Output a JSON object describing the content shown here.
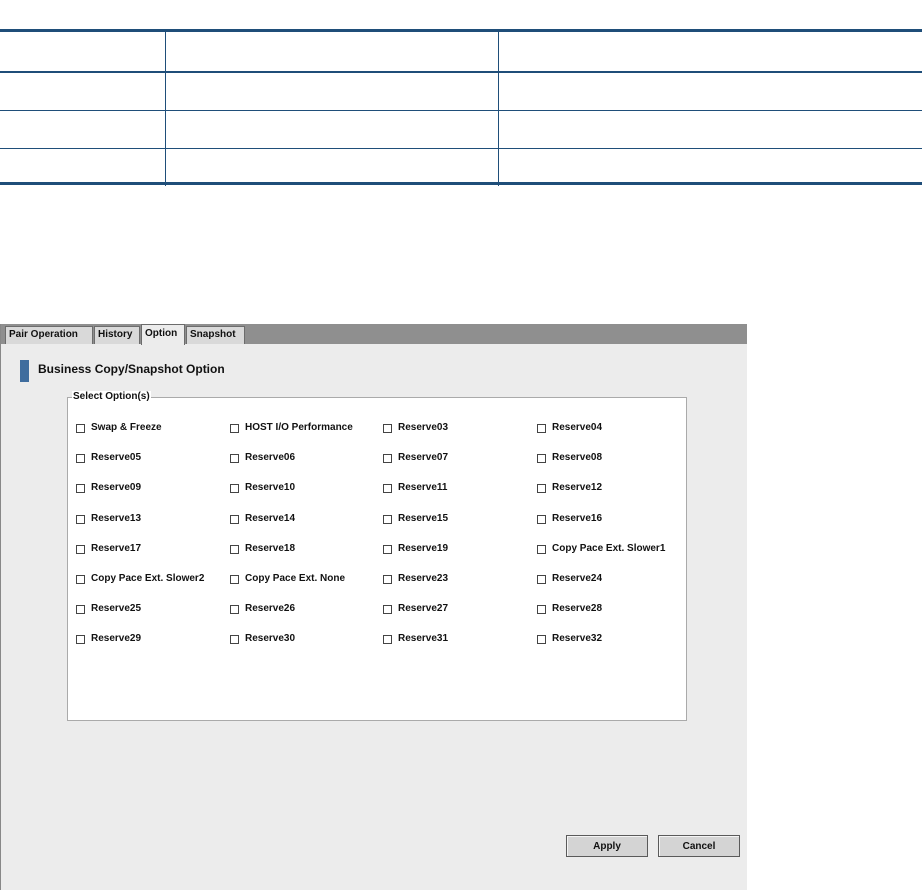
{
  "tabs": [
    {
      "label": "Pair Operation"
    },
    {
      "label": "History"
    },
    {
      "label": "Option",
      "active": true
    },
    {
      "label": "Snapshot"
    }
  ],
  "section": {
    "title": "Business Copy/Snapshot Option"
  },
  "group": {
    "legend": "Select Option(s)",
    "options": [
      "Swap & Freeze",
      "HOST I/O Performance",
      "Reserve03",
      "Reserve04",
      "Reserve05",
      "Reserve06",
      "Reserve07",
      "Reserve08",
      "Reserve09",
      "Reserve10",
      "Reserve11",
      "Reserve12",
      "Reserve13",
      "Reserve14",
      "Reserve15",
      "Reserve16",
      "Reserve17",
      "Reserve18",
      "Reserve19",
      "Copy Pace Ext. Slower1",
      "Copy Pace Ext. Slower2",
      "Copy Pace Ext. None",
      "Reserve23",
      "Reserve24",
      "Reserve25",
      "Reserve26",
      "Reserve27",
      "Reserve28",
      "Reserve29",
      "Reserve30",
      "Reserve31",
      "Reserve32"
    ]
  },
  "buttons": {
    "apply": "Apply",
    "cancel": "Cancel"
  },
  "colors": {
    "accent": "#3f6d9e",
    "table_rule": "#1f4e79"
  }
}
